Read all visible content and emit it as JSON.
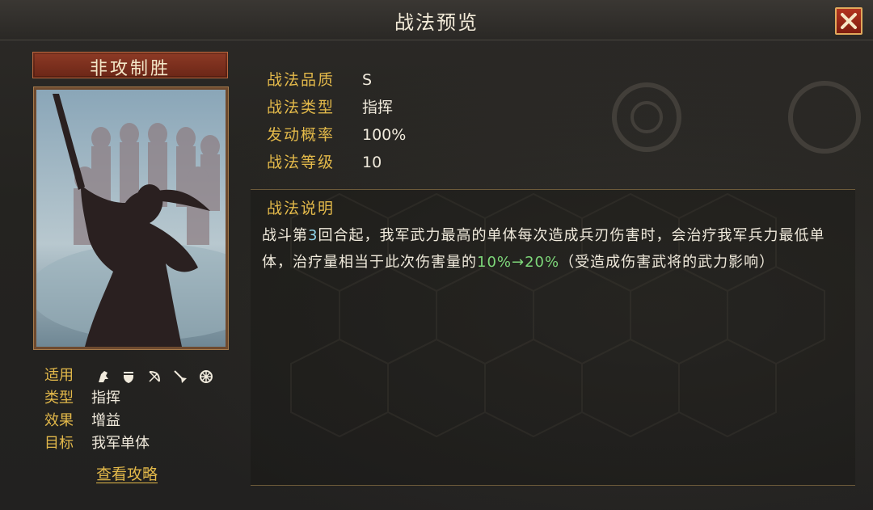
{
  "window": {
    "title": "战法预览"
  },
  "skill": {
    "name": "非攻制胜",
    "stats": [
      {
        "label": "战法品质",
        "value": "S"
      },
      {
        "label": "战法类型",
        "value": "指挥"
      },
      {
        "label": "发动概率",
        "value": "100%"
      },
      {
        "label": "战法等级",
        "value": "10"
      }
    ],
    "attributes": {
      "applicable_label": "适用",
      "troop_icons": [
        "cavalry-icon",
        "shield-icon",
        "bow-icon",
        "spear-icon",
        "wheel-icon"
      ],
      "type_label": "类型",
      "type_value": "指挥",
      "effect_label": "效果",
      "effect_value": "增益",
      "target_label": "目标",
      "target_value": "我军单体"
    },
    "guide_link": "查看攻略",
    "description": {
      "title": "战法说明",
      "text_before": "战斗第",
      "round_number": "3",
      "text_middle": "回合起，我军武力最高的单体每次造成兵刃伤害时，会治疗我军兵力最低单体，治疗量相当于此次伤害量的",
      "heal_range": "10%→20%",
      "text_after": "（受造成伤害武将的武力影响）"
    }
  },
  "colors": {
    "label_gold": "#e3b94a",
    "text_light": "#f0eadc",
    "highlight_green": "#7ed87a",
    "round_highlight": "#8fd2e8",
    "name_plate": "#8d3a25",
    "close_red": "#b2341f"
  }
}
